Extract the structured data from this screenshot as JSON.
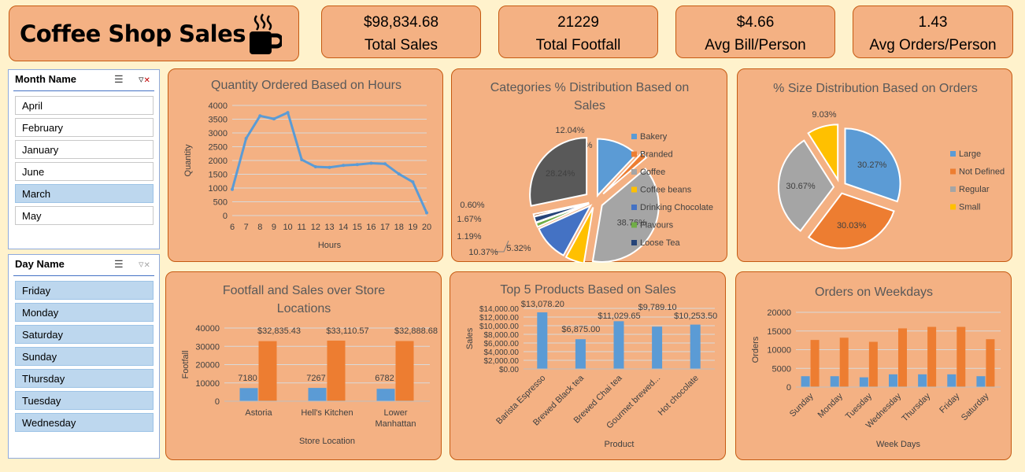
{
  "header": {
    "title": "Coffee Shop Sales"
  },
  "kpis": [
    {
      "value": "$98,834.68",
      "label": "Total Sales"
    },
    {
      "value": "21229",
      "label": "Total Footfall"
    },
    {
      "value": "$4.66",
      "label": "Avg Bill/Person"
    },
    {
      "value": "1.43",
      "label": "Avg Orders/Person"
    }
  ],
  "slicers": {
    "month": {
      "header": "Month Name",
      "items": [
        {
          "label": "April",
          "selected": false
        },
        {
          "label": "February",
          "selected": false
        },
        {
          "label": "January",
          "selected": false
        },
        {
          "label": "June",
          "selected": false
        },
        {
          "label": "March",
          "selected": true
        },
        {
          "label": "May",
          "selected": false
        }
      ]
    },
    "day": {
      "header": "Day Name",
      "items": [
        {
          "label": "Friday",
          "selected": true
        },
        {
          "label": "Monday",
          "selected": true
        },
        {
          "label": "Saturday",
          "selected": true
        },
        {
          "label": "Sunday",
          "selected": true
        },
        {
          "label": "Thursday",
          "selected": true
        },
        {
          "label": "Tuesday",
          "selected": true
        },
        {
          "label": "Wednesday",
          "selected": true
        }
      ]
    }
  },
  "icons": {
    "multi_select": "multi-select-icon",
    "clear_filter": "clear-filter-icon",
    "coffee": "coffee-cup-icon"
  },
  "colors": {
    "background": "#fff2cc",
    "card": "#f4b183",
    "card_border": "#c55a11",
    "blue": "#5b9bd5",
    "orange": "#ed7d31",
    "gray": "#a5a5a5",
    "yellow": "#ffc000",
    "darkblue": "#4472c4",
    "green": "#70ad47",
    "navy": "#264478",
    "darkgray": "#595959"
  },
  "chart_data": [
    {
      "id": "hours",
      "type": "line",
      "title": "Quantity Ordered Based on Hours",
      "xlabel": "Hours",
      "ylabel": "Quantity",
      "ylim": [
        0,
        4000
      ],
      "yticks": [
        "0",
        "500",
        "1000",
        "1500",
        "2000",
        "2500",
        "3000",
        "3500",
        "4000"
      ],
      "x": [
        "6",
        "7",
        "8",
        "9",
        "10",
        "11",
        "12",
        "13",
        "14",
        "15",
        "16",
        "17",
        "18",
        "19",
        "20"
      ],
      "series": [
        {
          "values": [
            950,
            2800,
            3620,
            3510,
            3740,
            2030,
            1770,
            1750,
            1820,
            1850,
            1900,
            1880,
            1510,
            1220,
            100
          ]
        }
      ]
    },
    {
      "id": "categories",
      "type": "pie",
      "title": "Categories % Distribution Based on Sales",
      "legend": "right",
      "slices": [
        {
          "name": "Bakery",
          "value": 12.04,
          "label": "12.04%"
        },
        {
          "name": "Branded",
          "value": 1.82,
          "label": "1.82%"
        },
        {
          "name": "Coffee",
          "value": 38.76,
          "label": "38.76%"
        },
        {
          "name": "Coffee beans",
          "value": 5.32,
          "label": "5.32%"
        },
        {
          "name": "Drinking Chocolate",
          "value": 10.37,
          "label": "10.37%"
        },
        {
          "name": "Flavours",
          "value": 1.19,
          "label": "1.19%"
        },
        {
          "name": "Loose Tea",
          "value": 1.67,
          "label": "1.67%"
        },
        {
          "name": "",
          "value": 0.6,
          "label": "0.60%"
        },
        {
          "name": "",
          "value": 28.24,
          "label": "28.24%"
        }
      ]
    },
    {
      "id": "sizes",
      "type": "pie",
      "title": "% Size Distribution Based on Orders",
      "legend": "right",
      "slices": [
        {
          "name": "Large",
          "value": 30.27,
          "label": "30.27%"
        },
        {
          "name": "Not Defined",
          "value": 30.03,
          "label": "30.03%"
        },
        {
          "name": "Regular",
          "value": 30.67,
          "label": "30.67%"
        },
        {
          "name": "Small",
          "value": 9.03,
          "label": "9.03%"
        }
      ]
    },
    {
      "id": "locations",
      "type": "bar",
      "title": "Footfall and Sales over Store Locations",
      "xlabel": "Store Location",
      "ylabel": "Footfall",
      "ylim": [
        0,
        40000
      ],
      "yticks": [
        "0",
        "10000",
        "20000",
        "30000",
        "40000"
      ],
      "categories": [
        "Astoria",
        "Hell's Kitchen",
        "Lower Manhattan"
      ],
      "series": [
        {
          "values": [
            7180,
            7267,
            6782
          ],
          "labels": [
            "7180",
            "7267",
            "6782"
          ]
        },
        {
          "values": [
            32835.43,
            33110.57,
            32888.68
          ],
          "labels": [
            "$32,835.43",
            "$33,110.57",
            "$32,888.68"
          ]
        }
      ]
    },
    {
      "id": "products",
      "type": "bar",
      "title": "Top 5 Products Based on Sales",
      "xlabel": "Product",
      "ylabel": "Sales",
      "ylim": [
        0,
        14000
      ],
      "yticks": [
        "$0.00",
        "$2,000.00",
        "$4,000.00",
        "$6,000.00",
        "$8,000.00",
        "$10,000.00",
        "$12,000.00",
        "$14,000.00"
      ],
      "categories": [
        "Barista Espresso",
        "Brewed Black tea",
        "Brewed Chai tea",
        "Gourmet brewed...",
        "Hot chocolate"
      ],
      "series": [
        {
          "values": [
            13078.2,
            6875.0,
            11029.65,
            9789.1,
            10253.5
          ],
          "labels": [
            "$13,078.20",
            "$6,875.00",
            "$11,029.65",
            "$9,789.10",
            "$10,253.50"
          ]
        }
      ]
    },
    {
      "id": "weekdays",
      "type": "bar",
      "title": "Orders on Weekdays",
      "xlabel": "Week Days",
      "ylabel": "Orders",
      "ylim": [
        0,
        20000
      ],
      "yticks": [
        "0",
        "5000",
        "10000",
        "15000",
        "20000"
      ],
      "categories": [
        "Sunday",
        "Monday",
        "Tuesday",
        "Wednesday",
        "Thursday",
        "Friday",
        "Saturday"
      ],
      "series": [
        {
          "values": [
            2900,
            2900,
            2600,
            3400,
            3400,
            3400,
            2900
          ]
        },
        {
          "values": [
            12600,
            13200,
            12100,
            15700,
            16100,
            16100,
            12800
          ]
        }
      ]
    }
  ]
}
